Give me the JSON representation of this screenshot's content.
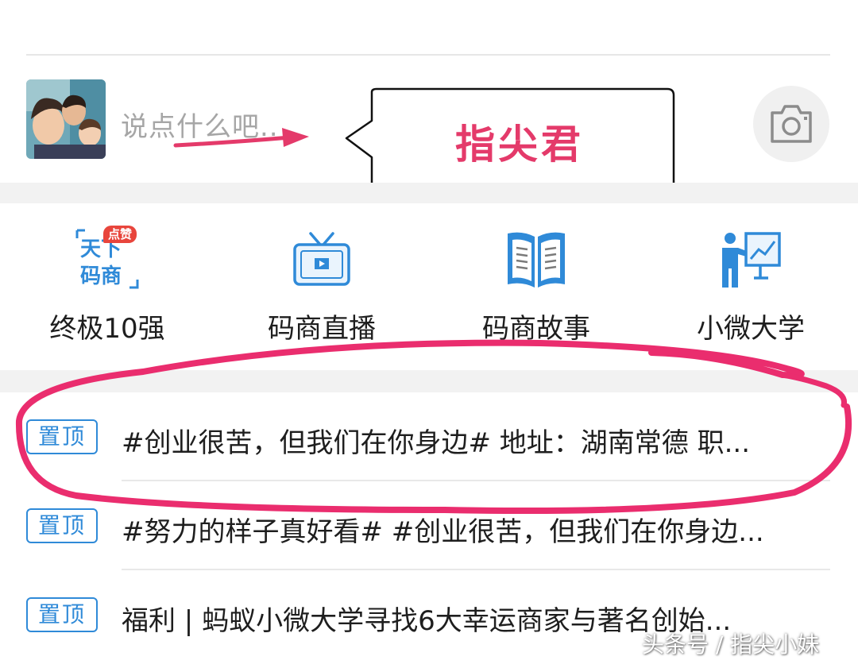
{
  "compose": {
    "placeholder": "说点什么吧..",
    "callout_text": "指尖君"
  },
  "menu": [
    {
      "label": "终极10强",
      "icon": "tianxia-mashang-icon",
      "badge": "点赞"
    },
    {
      "label": "码商直播",
      "icon": "tv-icon"
    },
    {
      "label": "码商故事",
      "icon": "open-book-icon"
    },
    {
      "label": "小微大学",
      "icon": "teacher-board-icon"
    }
  ],
  "feed": [
    {
      "tag": "置顶",
      "text": "#创业很苦，但我们在你身边# 地址：湖南常德 职..."
    },
    {
      "tag": "置顶",
      "text": "#努力的样子真好看# #创业很苦，但我们在你身边..."
    },
    {
      "tag": "置顶",
      "text": "福利 | 蚂蚁小微大学寻找6大幸运商家与著名创始..."
    }
  ],
  "watermark": "头条号 / 指尖小妹",
  "colors": {
    "accent_pink": "#e43a6a",
    "tag_blue": "#2f8ad8",
    "badge_red": "#e8453c",
    "band_gray": "#f2f2f2"
  }
}
